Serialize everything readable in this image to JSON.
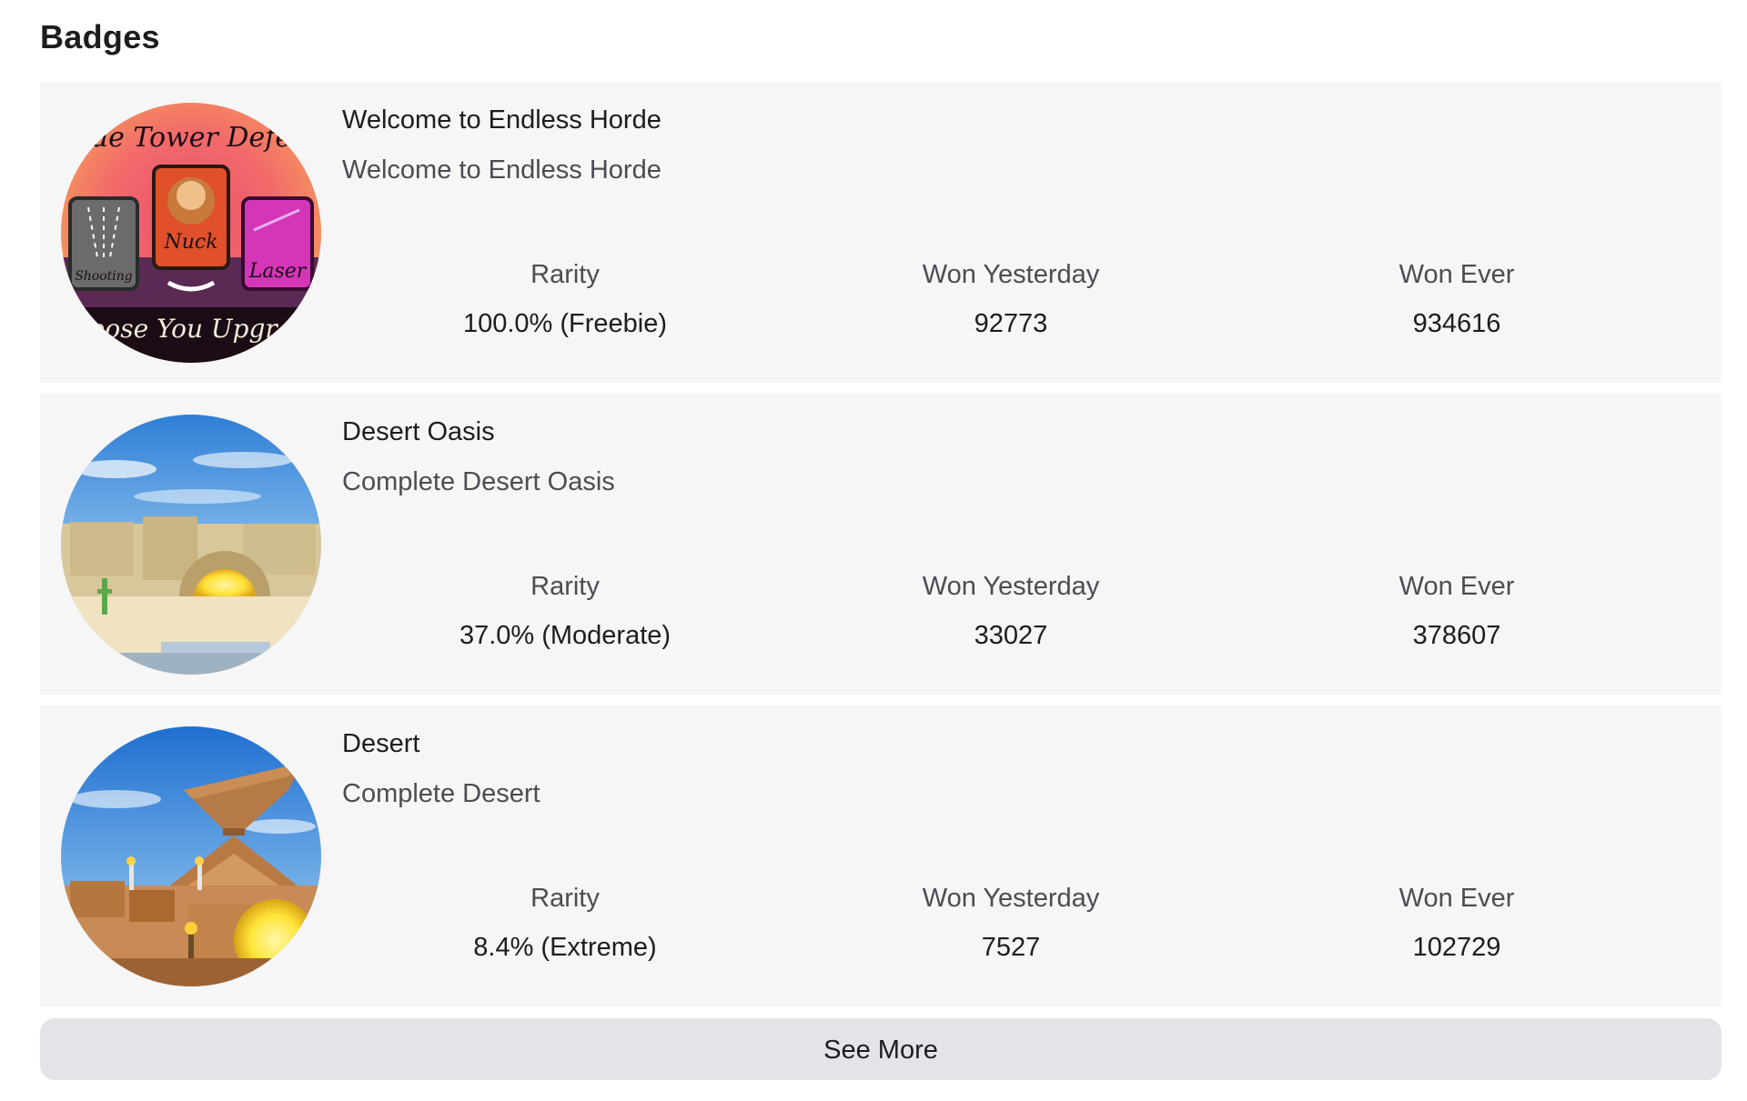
{
  "section": {
    "title": "Badges"
  },
  "badges": [
    {
      "name": "Welcome to Endless Horde",
      "description": "Welcome to Endless Horde",
      "image_icon": "badge-tower-defense-icon",
      "image_text": [
        "Rogue Tower Defense",
        "Shooting",
        "Nuck",
        "Laser",
        "Choose You Upgrade"
      ],
      "stats": [
        {
          "label": "Rarity",
          "value": "100.0% (Freebie)"
        },
        {
          "label": "Won Yesterday",
          "value": "92773"
        },
        {
          "label": "Won Ever",
          "value": "934616"
        }
      ]
    },
    {
      "name": "Desert Oasis",
      "description": "Complete Desert Oasis",
      "image_icon": "badge-desert-oasis-icon",
      "stats": [
        {
          "label": "Rarity",
          "value": "37.0% (Moderate)"
        },
        {
          "label": "Won Yesterday",
          "value": "33027"
        },
        {
          "label": "Won Ever",
          "value": "378607"
        }
      ]
    },
    {
      "name": "Desert",
      "description": "Complete Desert",
      "image_icon": "badge-desert-icon",
      "stats": [
        {
          "label": "Rarity",
          "value": "8.4% (Extreme)"
        },
        {
          "label": "Won Yesterday",
          "value": "7527"
        },
        {
          "label": "Won Ever",
          "value": "102729"
        }
      ]
    }
  ],
  "see_more": {
    "label": "See More"
  },
  "colors": {
    "card_background": "#f6f6f7",
    "button_background": "#e3e4e7",
    "primary_text": "#1c1d1f",
    "secondary_text": "#4a4d52"
  }
}
